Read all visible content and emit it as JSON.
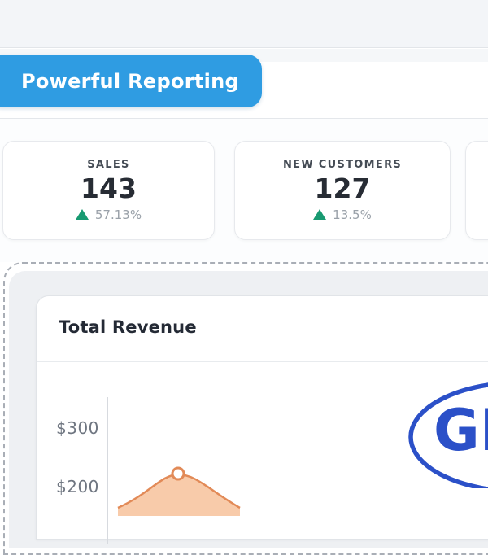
{
  "tab": {
    "label": "Powerful Reporting"
  },
  "stats": {
    "cards": [
      {
        "label": "SALES",
        "value": "143",
        "delta": "57.13%",
        "trend": "up"
      },
      {
        "label": "NEW CUSTOMERS",
        "value": "127",
        "delta": "13.5%",
        "trend": "up"
      },
      {
        "label": "",
        "value": "",
        "delta": "",
        "trend": ""
      }
    ]
  },
  "report": {
    "title": "Total Revenue",
    "chart_data": {
      "type": "area",
      "title": "Total Revenue",
      "ytick_labels": [
        "$300",
        "$200"
      ],
      "y_axis_prefix": "$",
      "grid": false,
      "series": [
        {
          "name": "revenue",
          "visible_points": [
            {
              "approx_value": 220,
              "marker": true
            }
          ]
        }
      ],
      "line_color": "#e28a57",
      "fill_color": "#f8cbaa",
      "cropped": true
    }
  },
  "watermark": {
    "text": "GR",
    "color": "#2b50c8"
  },
  "colors": {
    "accent_blue": "#2f9ce2",
    "trend_green": "#189a71",
    "stamp_blue": "#2b50c8",
    "curve_stroke": "#e28a57",
    "curve_fill": "#f8cbaa"
  }
}
